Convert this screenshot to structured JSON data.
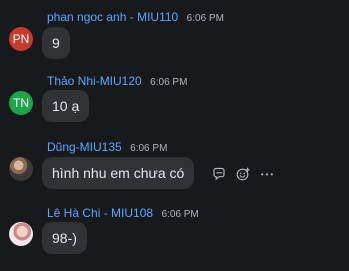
{
  "messages": [
    {
      "sender": "phan ngoc anh - MIU110",
      "time": "6:06 PM",
      "text": "9",
      "avatar": {
        "initials": "PN",
        "color": "#c43b2f"
      }
    },
    {
      "sender": "Thảo Nhi-MIU120",
      "time": "6:06 PM",
      "text": "10 ạ",
      "avatar": {
        "initials": "TN",
        "color": "#1fa34a"
      }
    },
    {
      "sender": "Dũng-MIU135",
      "time": "6:06 PM",
      "text": "hình nhu em chưa có",
      "avatar": {
        "type": "photo"
      }
    },
    {
      "sender": "Lê Hà Chi - MIU108",
      "time": "6:06 PM",
      "text": "98-)",
      "avatar": {
        "type": "photo"
      }
    }
  ],
  "hover_actions": [
    "reply-icon",
    "reaction-icon",
    "more-icon"
  ]
}
